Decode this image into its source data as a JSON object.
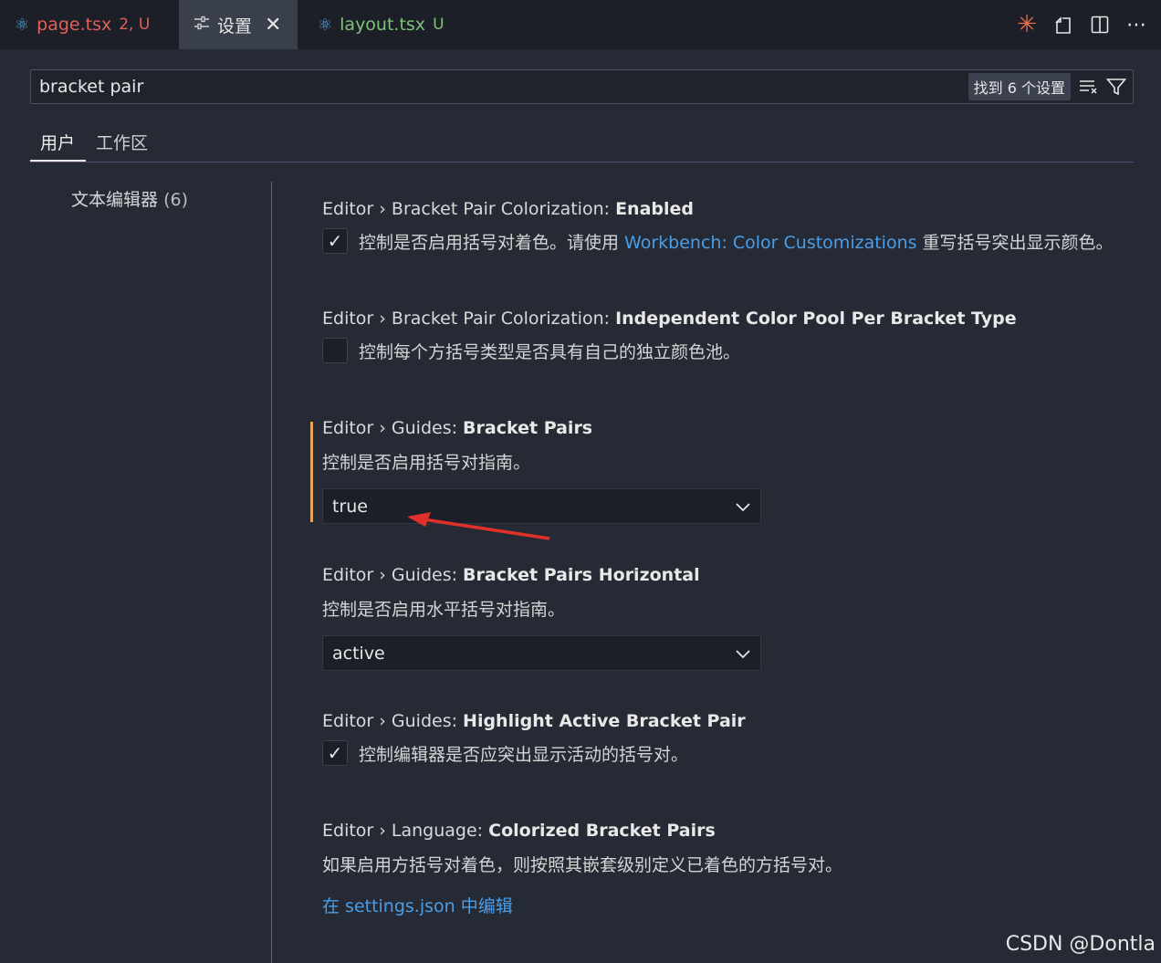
{
  "tabs": [
    {
      "label": "page.tsx",
      "badge": "2, U"
    },
    {
      "label": "设置",
      "close": "✕"
    },
    {
      "label": "layout.tsx",
      "badge": "U"
    }
  ],
  "search": {
    "value": "bracket pair",
    "found": "找到 6 个设置"
  },
  "scope_tabs": [
    "用户",
    "工作区"
  ],
  "toc": {
    "label": "文本编辑器",
    "count": "(6)"
  },
  "settings": [
    {
      "category": "Editor › Bracket Pair Colorization: ",
      "name": "Enabled",
      "checked": true,
      "desc_before": "控制是否启用括号对着色。请使用 ",
      "desc_link": "Workbench: Color Customizations",
      "desc_after": " 重写括号突出显示颜色。"
    },
    {
      "category": "Editor › Bracket Pair Colorization: ",
      "name": "Independent Color Pool Per Bracket Type",
      "checked": false,
      "desc": "控制每个方括号类型是否具有自己的独立颜色池。"
    },
    {
      "category": "Editor › Guides: ",
      "name": "Bracket Pairs",
      "desc": "控制是否启用括号对指南。",
      "value": "true"
    },
    {
      "category": "Editor › Guides: ",
      "name": "Bracket Pairs Horizontal",
      "desc": "控制是否启用水平括号对指南。",
      "value": "active"
    },
    {
      "category": "Editor › Guides: ",
      "name": "Highlight Active Bracket Pair",
      "checked": true,
      "desc": "控制编辑器是否应突出显示活动的括号对。"
    },
    {
      "category": "Editor › Language: ",
      "name": "Colorized Bracket Pairs",
      "desc": "如果启用方括号对着色，则按照其嵌套级别定义已着色的方括号对。",
      "link": "在 settings.json 中编辑"
    }
  ],
  "watermark": "CSDN @Dontla",
  "colors": {
    "link": "#4a9ee8",
    "modified": "#e6a55a",
    "annotation_arrow": "#e0302a"
  }
}
